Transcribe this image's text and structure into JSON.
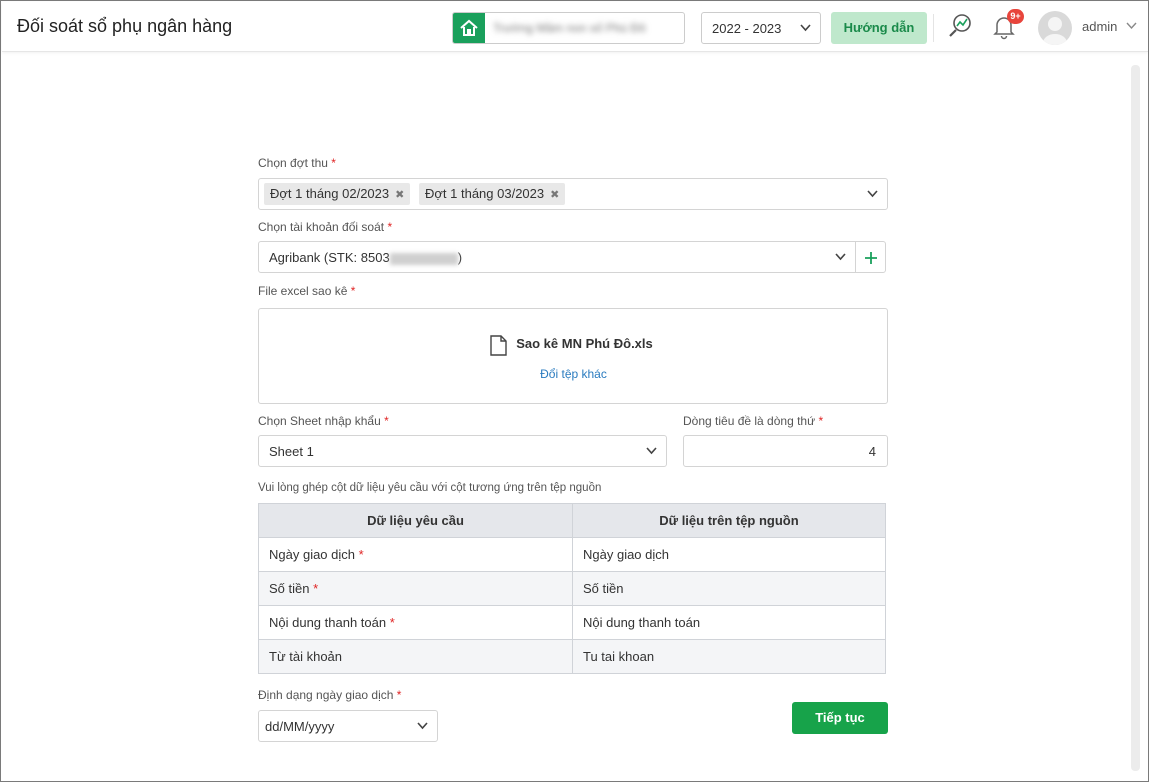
{
  "header": {
    "title": "Đối soát sổ phụ ngân hàng",
    "school_name": "Trường Mầm non số Phú Đô",
    "year": "2022 - 2023",
    "help_label": "Hướng dẫn",
    "notification_count": "9+",
    "user_name": "admin"
  },
  "form": {
    "period_label": "Chọn đợt thu",
    "period_tags": [
      "Đợt 1 tháng 02/2023",
      "Đợt 1 tháng 03/2023"
    ],
    "account_label": "Chọn tài khoản đối soát",
    "account_value_prefix": "Agribank (STK: 8503",
    "account_value_suffix": ")",
    "file_label": "File excel sao kê",
    "file_name": "Sao kê MN Phú Đô.xls",
    "file_change": "Đổi tệp khác",
    "sheet_label": "Chọn Sheet nhập khẩu",
    "sheet_value": "Sheet 1",
    "header_row_label": "Dòng tiêu đề là dòng thứ",
    "header_row_value": "4",
    "mapping_hint": "Vui lòng ghép cột dữ liệu yêu cầu với cột tương ứng trên tệp nguồn",
    "mapping_headers": [
      "Dữ liệu yêu cầu",
      "Dữ liệu trên tệp nguồn"
    ],
    "mapping_rows": [
      {
        "required": "Ngày giao dịch",
        "mandatory": "*",
        "source": "Ngày giao dịch"
      },
      {
        "required": "Số tiền",
        "mandatory": "*",
        "source": "Số tiền"
      },
      {
        "required": "Nội dung thanh toán",
        "mandatory": "*",
        "source": "Nội dung thanh toán"
      },
      {
        "required": "Từ tài khoản",
        "mandatory": "",
        "source": "Tu tai khoan"
      }
    ],
    "date_format_label": "Định dạng ngày giao dịch",
    "date_format_value": "dd/MM/yyyy",
    "required_mark": "*",
    "continue_label": "Tiếp tục"
  },
  "colors": {
    "brand_green": "#17a34a",
    "help_bg": "#bfe8cc",
    "badge_red": "#e8453c",
    "link_blue": "#2a7bbf"
  },
  "icons": [
    "home-icon",
    "chevron-down-icon",
    "analytics-icon",
    "bell-icon",
    "avatar",
    "close-icon",
    "plus-icon",
    "file-icon"
  ]
}
